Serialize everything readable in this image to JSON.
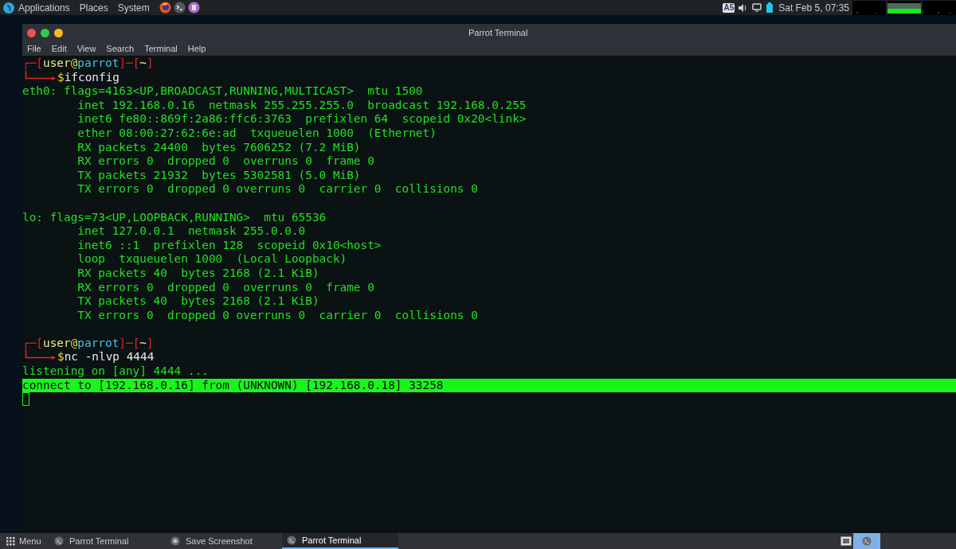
{
  "top_panel": {
    "menus": [
      "Applications",
      "Places",
      "System"
    ],
    "keyboard_layout": "A5",
    "clock": "Sat Feb 5, 07:35"
  },
  "window": {
    "title": "Parrot Terminal",
    "menu": [
      "File",
      "Edit",
      "View",
      "Search",
      "Terminal",
      "Help"
    ],
    "lines": [
      {
        "kind": "prompt",
        "segments": [
          {
            "kind": "frame",
            "text": "┌─["
          },
          {
            "kind": "user",
            "text": "user"
          },
          {
            "kind": "at",
            "text": "@"
          },
          {
            "kind": "host",
            "text": "parrot"
          },
          {
            "kind": "frame",
            "text": "]─["
          },
          {
            "kind": "dir",
            "text": "~"
          },
          {
            "kind": "frame",
            "text": "]"
          }
        ]
      },
      {
        "kind": "command",
        "dollar": "$",
        "text": "ifconfig"
      },
      {
        "kind": "output",
        "text": "eth0: flags=4163<UP,BROADCAST,RUNNING,MULTICAST>  mtu 1500"
      },
      {
        "kind": "output",
        "text": "        inet 192.168.0.16  netmask 255.255.255.0  broadcast 192.168.0.255"
      },
      {
        "kind": "output",
        "text": "        inet6 fe80::869f:2a86:ffc6:3763  prefixlen 64  scopeid 0x20<link>"
      },
      {
        "kind": "output",
        "text": "        ether 08:00:27:62:6e:ad  txqueuelen 1000  (Ethernet)"
      },
      {
        "kind": "output",
        "text": "        RX packets 24400  bytes 7606252 (7.2 MiB)"
      },
      {
        "kind": "output",
        "text": "        RX errors 0  dropped 0  overruns 0  frame 0"
      },
      {
        "kind": "output",
        "text": "        TX packets 21932  bytes 5302581 (5.0 MiB)"
      },
      {
        "kind": "output",
        "text": "        TX errors 0  dropped 0 overruns 0  carrier 0  collisions 0"
      },
      {
        "kind": "blank"
      },
      {
        "kind": "output",
        "text": "lo: flags=73<UP,LOOPBACK,RUNNING>  mtu 65536"
      },
      {
        "kind": "output",
        "text": "        inet 127.0.0.1  netmask 255.0.0.0"
      },
      {
        "kind": "output",
        "text": "        inet6 ::1  prefixlen 128  scopeid 0x10<host>"
      },
      {
        "kind": "output",
        "text": "        loop  txqueuelen 1000  (Local Loopback)"
      },
      {
        "kind": "output",
        "text": "        RX packets 40  bytes 2168 (2.1 KiB)"
      },
      {
        "kind": "output",
        "text": "        RX errors 0  dropped 0  overruns 0  frame 0"
      },
      {
        "kind": "output",
        "text": "        TX packets 40  bytes 2168 (2.1 KiB)"
      },
      {
        "kind": "output",
        "text": "        TX errors 0  dropped 0 overruns 0  carrier 0  collisions 0"
      },
      {
        "kind": "blank"
      },
      {
        "kind": "prompt",
        "segments": [
          {
            "kind": "frame",
            "text": "┌─["
          },
          {
            "kind": "user",
            "text": "user"
          },
          {
            "kind": "at",
            "text": "@"
          },
          {
            "kind": "host",
            "text": "parrot"
          },
          {
            "kind": "frame",
            "text": "]─["
          },
          {
            "kind": "dir",
            "text": "~"
          },
          {
            "kind": "frame",
            "text": "]"
          }
        ]
      },
      {
        "kind": "command",
        "dollar": "$",
        "text": "nc -nlvp 4444"
      },
      {
        "kind": "output",
        "text": "listening on [any] 4444 ..."
      },
      {
        "kind": "highlight",
        "text": "connect to [192.168.0.16] from (UNKNOWN) [192.168.0.18] 33258"
      },
      {
        "kind": "cursor"
      }
    ]
  },
  "taskbar": {
    "menu": "Menu",
    "tasks": [
      {
        "label": "Parrot Terminal",
        "kind": "terminal",
        "selected": false
      },
      {
        "label": "Save Screenshot",
        "kind": "camera",
        "selected": false
      },
      {
        "label": "Parrot Terminal",
        "kind": "terminal",
        "selected": true
      }
    ]
  }
}
